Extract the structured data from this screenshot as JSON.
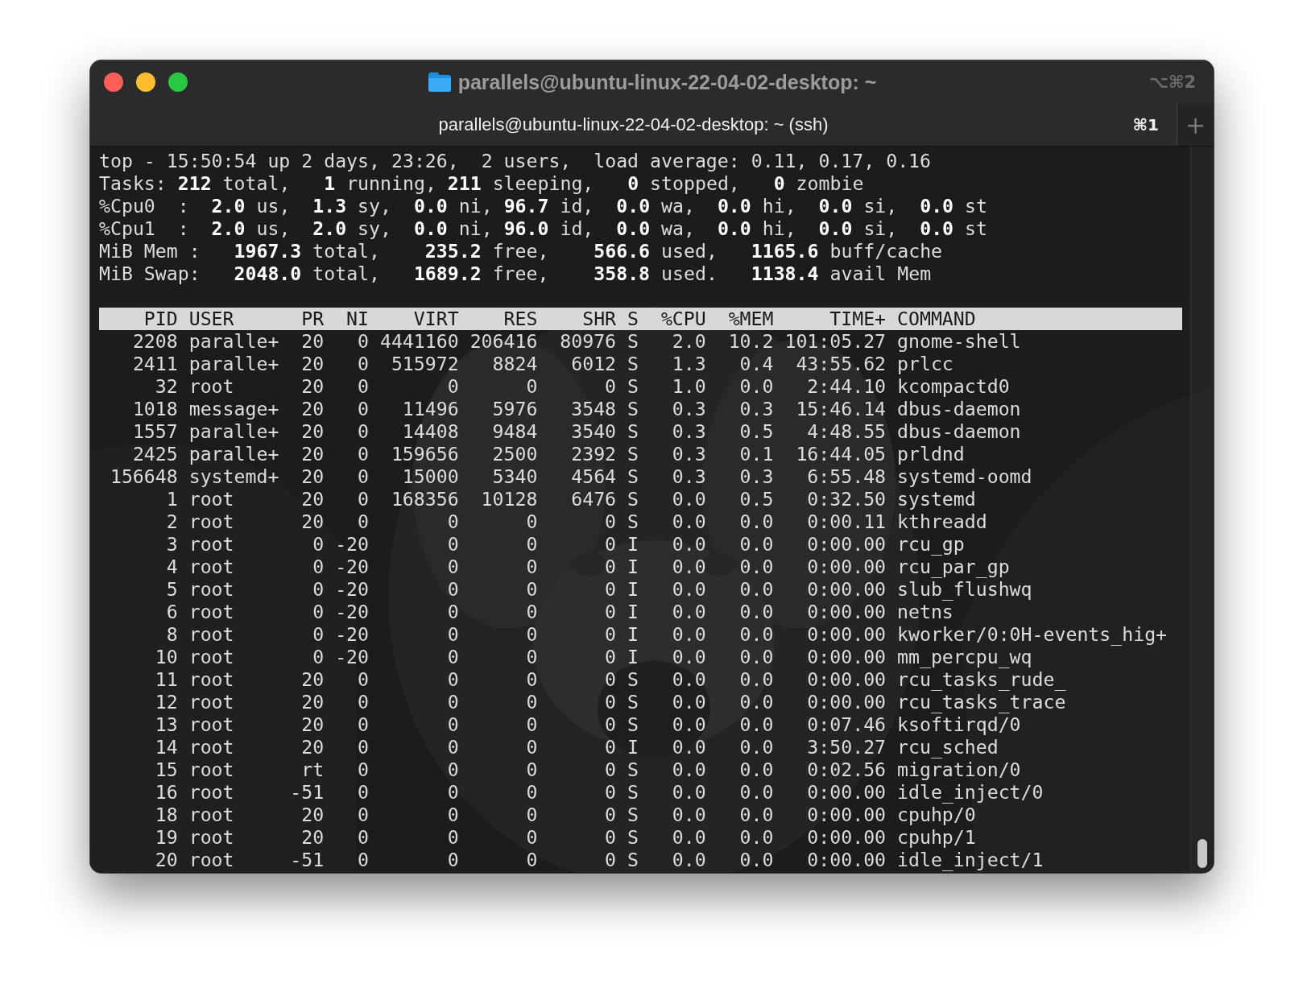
{
  "window": {
    "title": "parallels@ubuntu-linux-22-04-02-desktop: ~",
    "shortcut": "⌥⌘2"
  },
  "tabs": [
    {
      "label": "parallels@ubuntu-linux-22-04-02-desktop: ~ (ssh)",
      "shortcut": "⌘1"
    }
  ],
  "new_tab_button": "+",
  "summary": [
    "top - 15:50:54 up 2 days, 23:26,  2 users,  load average: 0.11, 0.17, 0.16",
    "Tasks: **212** total,   **1** running, **211** sleeping,   **0** stopped,   **0** zombie",
    "%Cpu0  :  **2.0** us,  **1.3** sy,  **0.0** ni, **96.7** id,  **0.0** wa,  **0.0** hi,  **0.0** si,  **0.0** st",
    "%Cpu1  :  **2.0** us,  **2.0** sy,  **0.0** ni, **96.0** id,  **0.0** wa,  **0.0** hi,  **0.0** si,  **0.0** st",
    "MiB Mem :   **1967.3** total,    **235.2** free,    **566.6** used,   **1165.6** buff/cache",
    "MiB Swap:   **2048.0** total,   **1689.2** free,    **358.8** used.   **1138.4** avail Mem"
  ],
  "table": {
    "columns": [
      "PID",
      "USER",
      "PR",
      "NI",
      "VIRT",
      "RES",
      "SHR",
      "S",
      "%CPU",
      "%MEM",
      "TIME+",
      "COMMAND"
    ],
    "rows": [
      [
        "2208",
        "paralle+",
        "20",
        "0",
        "4441160",
        "206416",
        "80976",
        "S",
        "2.0",
        "10.2",
        "101:05.27",
        "gnome-shell"
      ],
      [
        "2411",
        "paralle+",
        "20",
        "0",
        "515972",
        "8824",
        "6012",
        "S",
        "1.3",
        "0.4",
        "43:55.62",
        "prlcc"
      ],
      [
        "32",
        "root",
        "20",
        "0",
        "0",
        "0",
        "0",
        "S",
        "1.0",
        "0.0",
        "2:44.10",
        "kcompactd0"
      ],
      [
        "1018",
        "message+",
        "20",
        "0",
        "11496",
        "5976",
        "3548",
        "S",
        "0.3",
        "0.3",
        "15:46.14",
        "dbus-daemon"
      ],
      [
        "1557",
        "paralle+",
        "20",
        "0",
        "14408",
        "9484",
        "3540",
        "S",
        "0.3",
        "0.5",
        "4:48.55",
        "dbus-daemon"
      ],
      [
        "2425",
        "paralle+",
        "20",
        "0",
        "159656",
        "2500",
        "2392",
        "S",
        "0.3",
        "0.1",
        "16:44.05",
        "prldnd"
      ],
      [
        "156648",
        "systemd+",
        "20",
        "0",
        "15000",
        "5340",
        "4564",
        "S",
        "0.3",
        "0.3",
        "6:55.48",
        "systemd-oomd"
      ],
      [
        "1",
        "root",
        "20",
        "0",
        "168356",
        "10128",
        "6476",
        "S",
        "0.0",
        "0.5",
        "0:32.50",
        "systemd"
      ],
      [
        "2",
        "root",
        "20",
        "0",
        "0",
        "0",
        "0",
        "S",
        "0.0",
        "0.0",
        "0:00.11",
        "kthreadd"
      ],
      [
        "3",
        "root",
        "0",
        "-20",
        "0",
        "0",
        "0",
        "I",
        "0.0",
        "0.0",
        "0:00.00",
        "rcu_gp"
      ],
      [
        "4",
        "root",
        "0",
        "-20",
        "0",
        "0",
        "0",
        "I",
        "0.0",
        "0.0",
        "0:00.00",
        "rcu_par_gp"
      ],
      [
        "5",
        "root",
        "0",
        "-20",
        "0",
        "0",
        "0",
        "I",
        "0.0",
        "0.0",
        "0:00.00",
        "slub_flushwq"
      ],
      [
        "6",
        "root",
        "0",
        "-20",
        "0",
        "0",
        "0",
        "I",
        "0.0",
        "0.0",
        "0:00.00",
        "netns"
      ],
      [
        "8",
        "root",
        "0",
        "-20",
        "0",
        "0",
        "0",
        "I",
        "0.0",
        "0.0",
        "0:00.00",
        "kworker/0:0H-events_hig+"
      ],
      [
        "10",
        "root",
        "0",
        "-20",
        "0",
        "0",
        "0",
        "I",
        "0.0",
        "0.0",
        "0:00.00",
        "mm_percpu_wq"
      ],
      [
        "11",
        "root",
        "20",
        "0",
        "0",
        "0",
        "0",
        "S",
        "0.0",
        "0.0",
        "0:00.00",
        "rcu_tasks_rude_"
      ],
      [
        "12",
        "root",
        "20",
        "0",
        "0",
        "0",
        "0",
        "S",
        "0.0",
        "0.0",
        "0:00.00",
        "rcu_tasks_trace"
      ],
      [
        "13",
        "root",
        "20",
        "0",
        "0",
        "0",
        "0",
        "S",
        "0.0",
        "0.0",
        "0:07.46",
        "ksoftirqd/0"
      ],
      [
        "14",
        "root",
        "20",
        "0",
        "0",
        "0",
        "0",
        "I",
        "0.0",
        "0.0",
        "3:50.27",
        "rcu_sched"
      ],
      [
        "15",
        "root",
        "rt",
        "0",
        "0",
        "0",
        "0",
        "S",
        "0.0",
        "0.0",
        "0:02.56",
        "migration/0"
      ],
      [
        "16",
        "root",
        "-51",
        "0",
        "0",
        "0",
        "0",
        "S",
        "0.0",
        "0.0",
        "0:00.00",
        "idle_inject/0"
      ],
      [
        "18",
        "root",
        "20",
        "0",
        "0",
        "0",
        "0",
        "S",
        "0.0",
        "0.0",
        "0:00.00",
        "cpuhp/0"
      ],
      [
        "19",
        "root",
        "20",
        "0",
        "0",
        "0",
        "0",
        "S",
        "0.0",
        "0.0",
        "0:00.00",
        "cpuhp/1"
      ],
      [
        "20",
        "root",
        "-51",
        "0",
        "0",
        "0",
        "0",
        "S",
        "0.0",
        "0.0",
        "0:00.00",
        "idle_inject/1"
      ]
    ]
  }
}
